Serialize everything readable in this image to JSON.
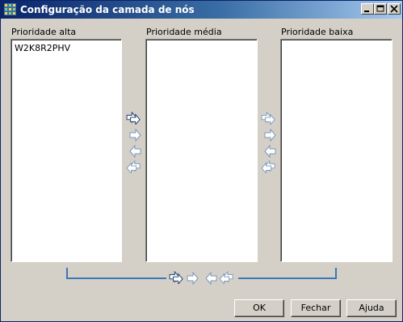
{
  "window": {
    "title": "Configuração da camada de nós"
  },
  "columns": [
    {
      "label": "Prioridade alta",
      "items": [
        "W2K8R2PHV"
      ]
    },
    {
      "label": "Prioridade média",
      "items": []
    },
    {
      "label": "Prioridade baixa",
      "items": []
    }
  ],
  "buttons": {
    "ok": "OK",
    "close": "Fechar",
    "help": "Ajuda"
  },
  "icons": {
    "move_all_right": "double-right-arrow-icon",
    "move_right": "right-arrow-icon",
    "move_left": "left-arrow-icon",
    "move_all_left": "double-left-arrow-icon"
  },
  "colors": {
    "titlebar_start": "#0a246a",
    "titlebar_end": "#a6caf0",
    "bracket": "#3a78b8",
    "face": "#d4d0c8"
  }
}
